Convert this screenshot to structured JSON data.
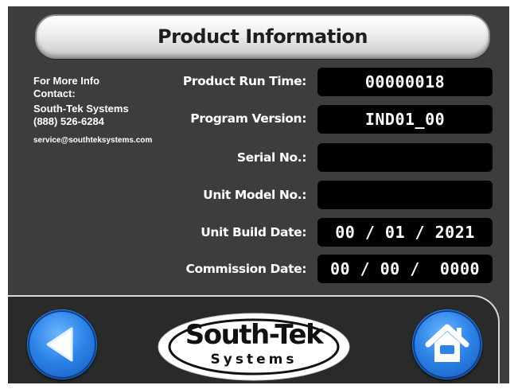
{
  "title": "Product Information",
  "contact": {
    "line1": "For More Info",
    "line2": "Contact:",
    "company": "South-Tek Systems",
    "phone": "(888) 526-6284",
    "email": "service@southteksystems.com"
  },
  "rows": [
    {
      "label": "Product Run Time:",
      "value": "00000018"
    },
    {
      "label": "Program Version:",
      "value": "IND01_00"
    },
    {
      "label": "Serial No.:",
      "value": ""
    },
    {
      "label": "Unit Model No.:",
      "value": ""
    },
    {
      "label": "Unit Build Date:",
      "value": "00 / 01 / 2021"
    },
    {
      "label": "Commission Date:",
      "value": "00 / 00 /  0000"
    }
  ],
  "logo": {
    "main": "South-Tek",
    "sub": "Systems"
  },
  "icons": {
    "back": "back-arrow-icon",
    "home": "home-icon"
  },
  "colors": {
    "background": "#3d3d3d",
    "field": "#000000",
    "button": "#2d84e8"
  }
}
